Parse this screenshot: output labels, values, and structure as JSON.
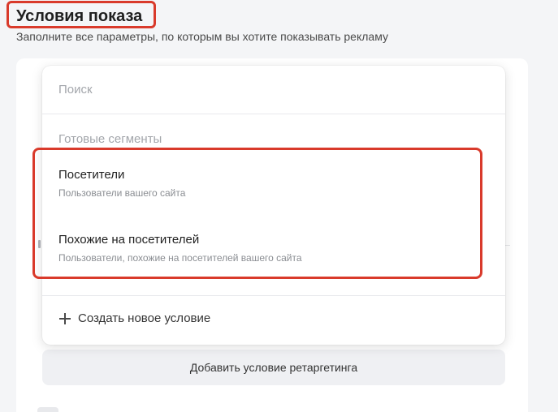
{
  "section": {
    "title": "Условия показа",
    "subtitle": "Заполните все параметры, по которым вы хотите показывать рекламу"
  },
  "dropdown": {
    "search_placeholder": "Поиск",
    "group_label": "Готовые сегменты",
    "options": [
      {
        "title": "Посетители",
        "description": "Пользователи вашего сайта"
      },
      {
        "title": "Похожие на посетителей",
        "description": "Пользователи, похожие на посетителей вашего сайта"
      }
    ],
    "create_label": "Создать новое условие",
    "create_icon": "plus-icon"
  },
  "actions": {
    "add_retargeting_label": "Добавить условие ретаргетинга"
  },
  "colors": {
    "highlight": "#d93a2b",
    "button_bg": "#eff0f3",
    "placeholder": "#a3a6ab"
  }
}
